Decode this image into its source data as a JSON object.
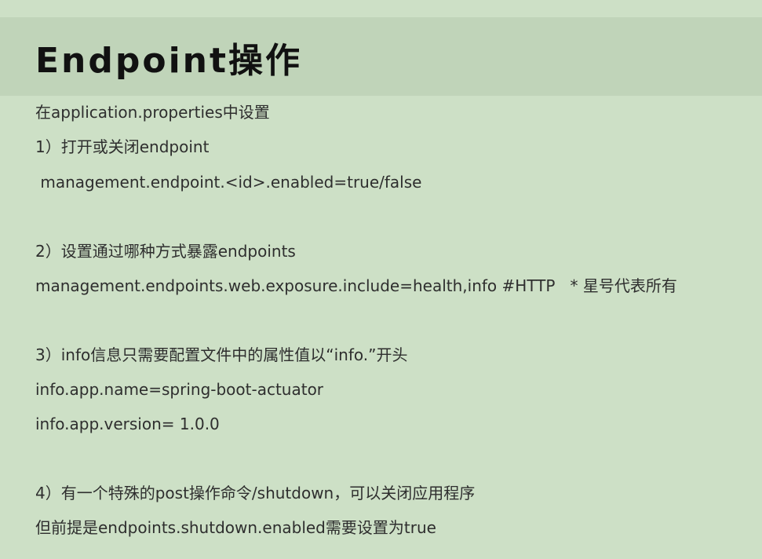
{
  "title": "Endpoint操作",
  "lines": [
    "在application.properties中设置",
    "1）打开或关闭endpoint",
    " management.endpoint.<id>.enabled=true/false",
    "2）设置通过哪种方式暴露endpoints",
    "management.endpoints.web.exposure.include=health,info #HTTP   * 星号代表所有",
    "3）info信息只需要配置文件中的属性值以“info.”开头",
    "info.app.name=spring-boot-actuator",
    "info.app.version= 1.0.0",
    "4）有一个特殊的post操作命令/shutdown，可以关闭应用程序",
    "但前提是endpoints.shutdown.enabled需要设置为true"
  ]
}
